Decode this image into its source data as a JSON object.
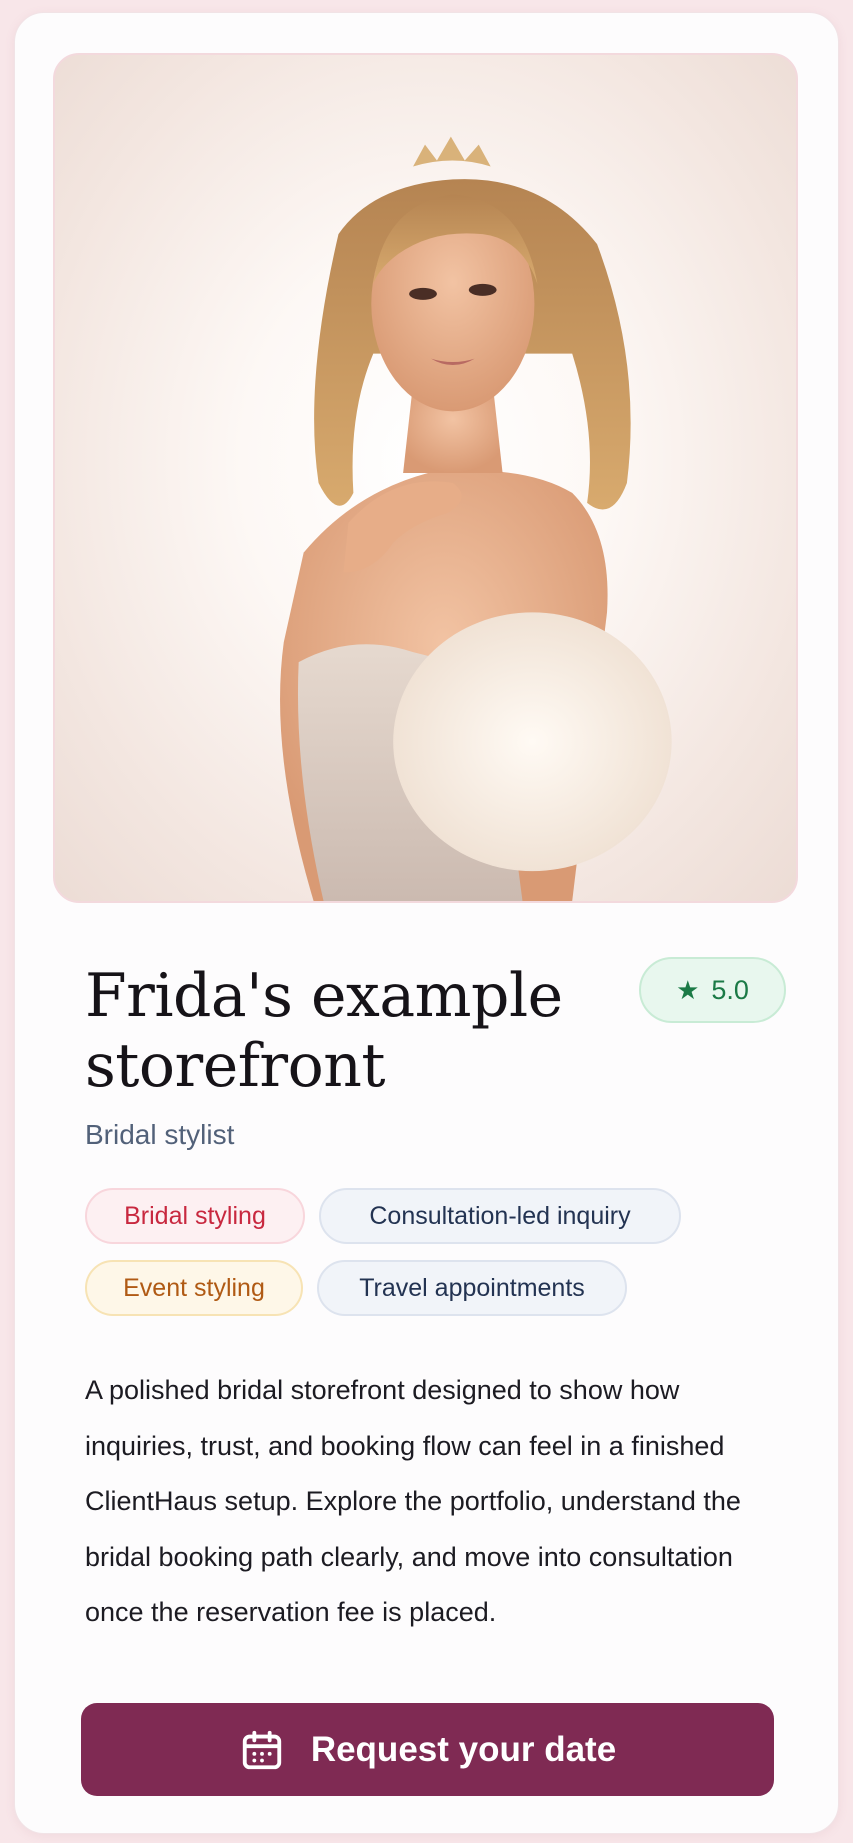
{
  "profile": {
    "title": "Frida's example storefront",
    "subtitle": "Bridal stylist",
    "rating": "5.0",
    "rating_icon": "star-icon",
    "hero_image": "bridal-portrait-photo"
  },
  "tags": [
    {
      "label": "Bridal styling",
      "tone": "red"
    },
    {
      "label": "Consultation-led inquiry",
      "tone": "blue"
    },
    {
      "label": "Event styling",
      "tone": "amber"
    },
    {
      "label": "Travel appointments",
      "tone": "blue"
    }
  ],
  "description": "A polished bridal storefront designed to show how inquiries, trust, and booking flow can feel in a finished ClientHaus setup. Explore the portfolio, understand the bridal booking path clearly, and move into consultation once the reservation fee is placed.",
  "cta": {
    "label": "Request your date",
    "icon": "calendar-icon"
  },
  "colors": {
    "accent": "#7f2a53",
    "rating_green": "#1b7a46",
    "tag_red": "#c8283f",
    "tag_amber": "#b05a14",
    "tag_blue": "#233352",
    "background": "#f8e6e9"
  }
}
